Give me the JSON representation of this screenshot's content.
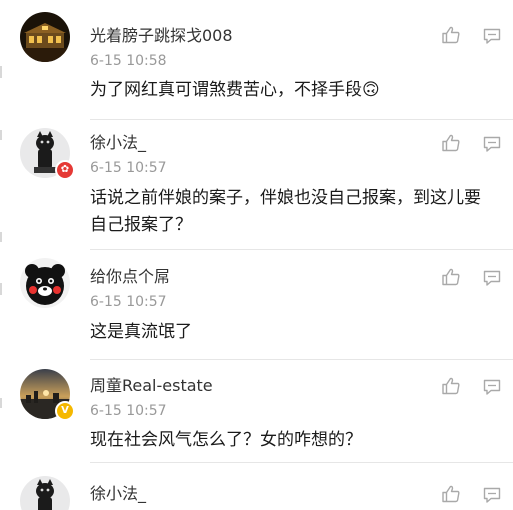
{
  "comments": [
    {
      "username": "光着膀子跳探戈008",
      "time": "6-15 10:58",
      "text": "为了网红真可谓煞费苦心，不择手段🙃",
      "avatar_icon": "night-building-avatar",
      "badge": null
    },
    {
      "username": "徐小法_",
      "time": "6-15 10:57",
      "text": "话说之前伴娘的案子，伴娘也没自己报案，到这儿要自己报案了？",
      "avatar_icon": "black-cat-figure-avatar",
      "badge": {
        "icon": "red-emblem-badge",
        "color": "#e53935"
      }
    },
    {
      "username": "给你点个屌",
      "time": "6-15 10:57",
      "text": "这是真流氓了",
      "avatar_icon": "kumamon-bear-avatar",
      "badge": null
    },
    {
      "username": "周童Real-estate",
      "time": "6-15 10:57",
      "text": "现在社会风气怎么了？女的咋想的？",
      "avatar_icon": "sunset-cityscape-avatar",
      "badge": {
        "icon": "verified-v-badge",
        "color": "#f5b800"
      }
    },
    {
      "username": "徐小法_",
      "time": "",
      "text": "",
      "avatar_icon": "black-cat-figure-avatar",
      "badge": null
    }
  ],
  "icons": {
    "like": "thumbs-up-icon",
    "reply": "comment-reply-icon"
  },
  "colors": {
    "username": "#333333",
    "timestamp": "#999999",
    "icon": "#a9a9a9",
    "divider": "#e6e6e6"
  }
}
